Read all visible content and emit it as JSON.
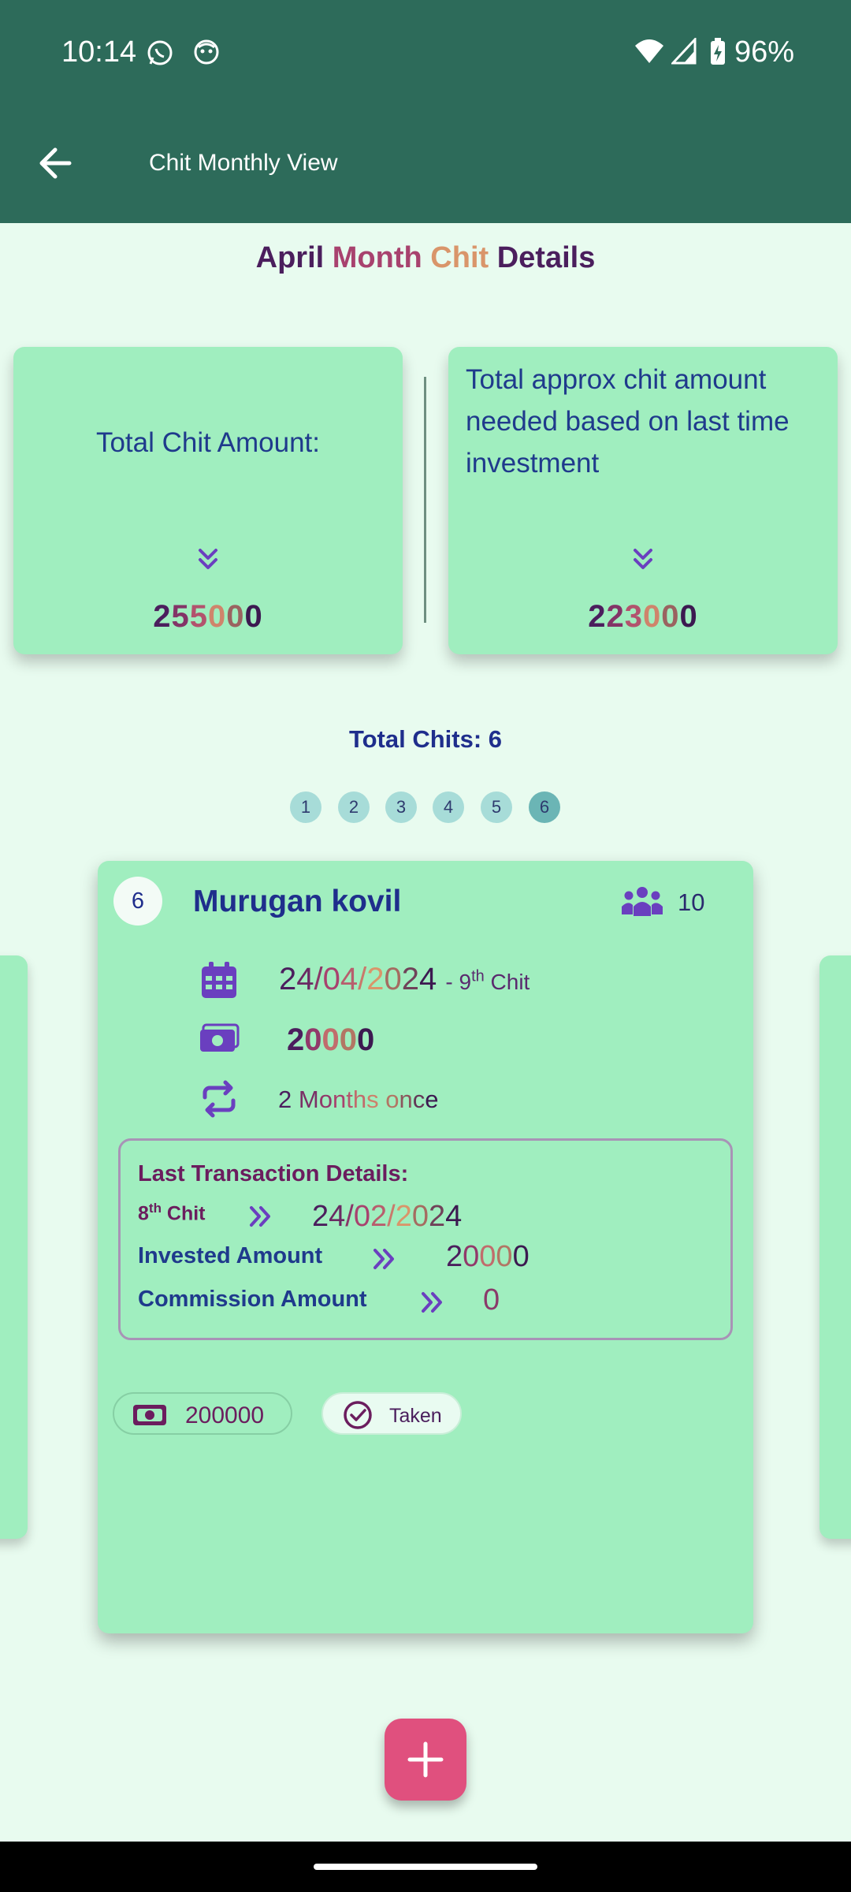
{
  "status_bar": {
    "time": "10:14",
    "battery": "96%"
  },
  "app_bar": {
    "title": "Chit Monthly View"
  },
  "heading": {
    "parts": [
      "April",
      " Month",
      " Chit",
      " Details"
    ]
  },
  "summary": {
    "total_label": "Total Chit Amount:",
    "total_value": "255000",
    "approx_label": "Total approx chit amount needed based on last time investment",
    "approx_value": "223000"
  },
  "total_chits": "Total Chits: 6",
  "pager": {
    "pages": [
      "1",
      "2",
      "3",
      "4",
      "5",
      "6"
    ],
    "active": 6
  },
  "chit": {
    "number": "6",
    "name": "Murugan kovil",
    "members": "10",
    "date": "24/04/2024",
    "chit_no_prefix": "- 9",
    "chit_no_sup": "th",
    "chit_no_suffix": " Chit",
    "amount": "20000",
    "frequency": "2 Months once",
    "last": {
      "title": "Last Transaction Details:",
      "chit_no": "8",
      "chit_sup": "th",
      "chit_suffix": " Chit",
      "date": "24/02/2024",
      "invested_label": "Invested Amount",
      "invested_value": "20000",
      "commission_label": "Commission Amount",
      "commission_value": "0"
    },
    "total_amount_chip": "200000",
    "status_chip": "Taken"
  },
  "colors": {
    "app_bar": "#2D6B5A",
    "background": "#E8FBEF",
    "card": "#A0EEBF",
    "fab": "#E0507E",
    "icon_purple": "#6A3FBF"
  },
  "icons": [
    "back-arrow",
    "whatsapp",
    "notification-face",
    "wifi",
    "signal",
    "battery-charging",
    "chevrons-down",
    "people",
    "calendar",
    "money",
    "repeat",
    "double-chevron-right",
    "cash",
    "check-circle",
    "plus"
  ]
}
